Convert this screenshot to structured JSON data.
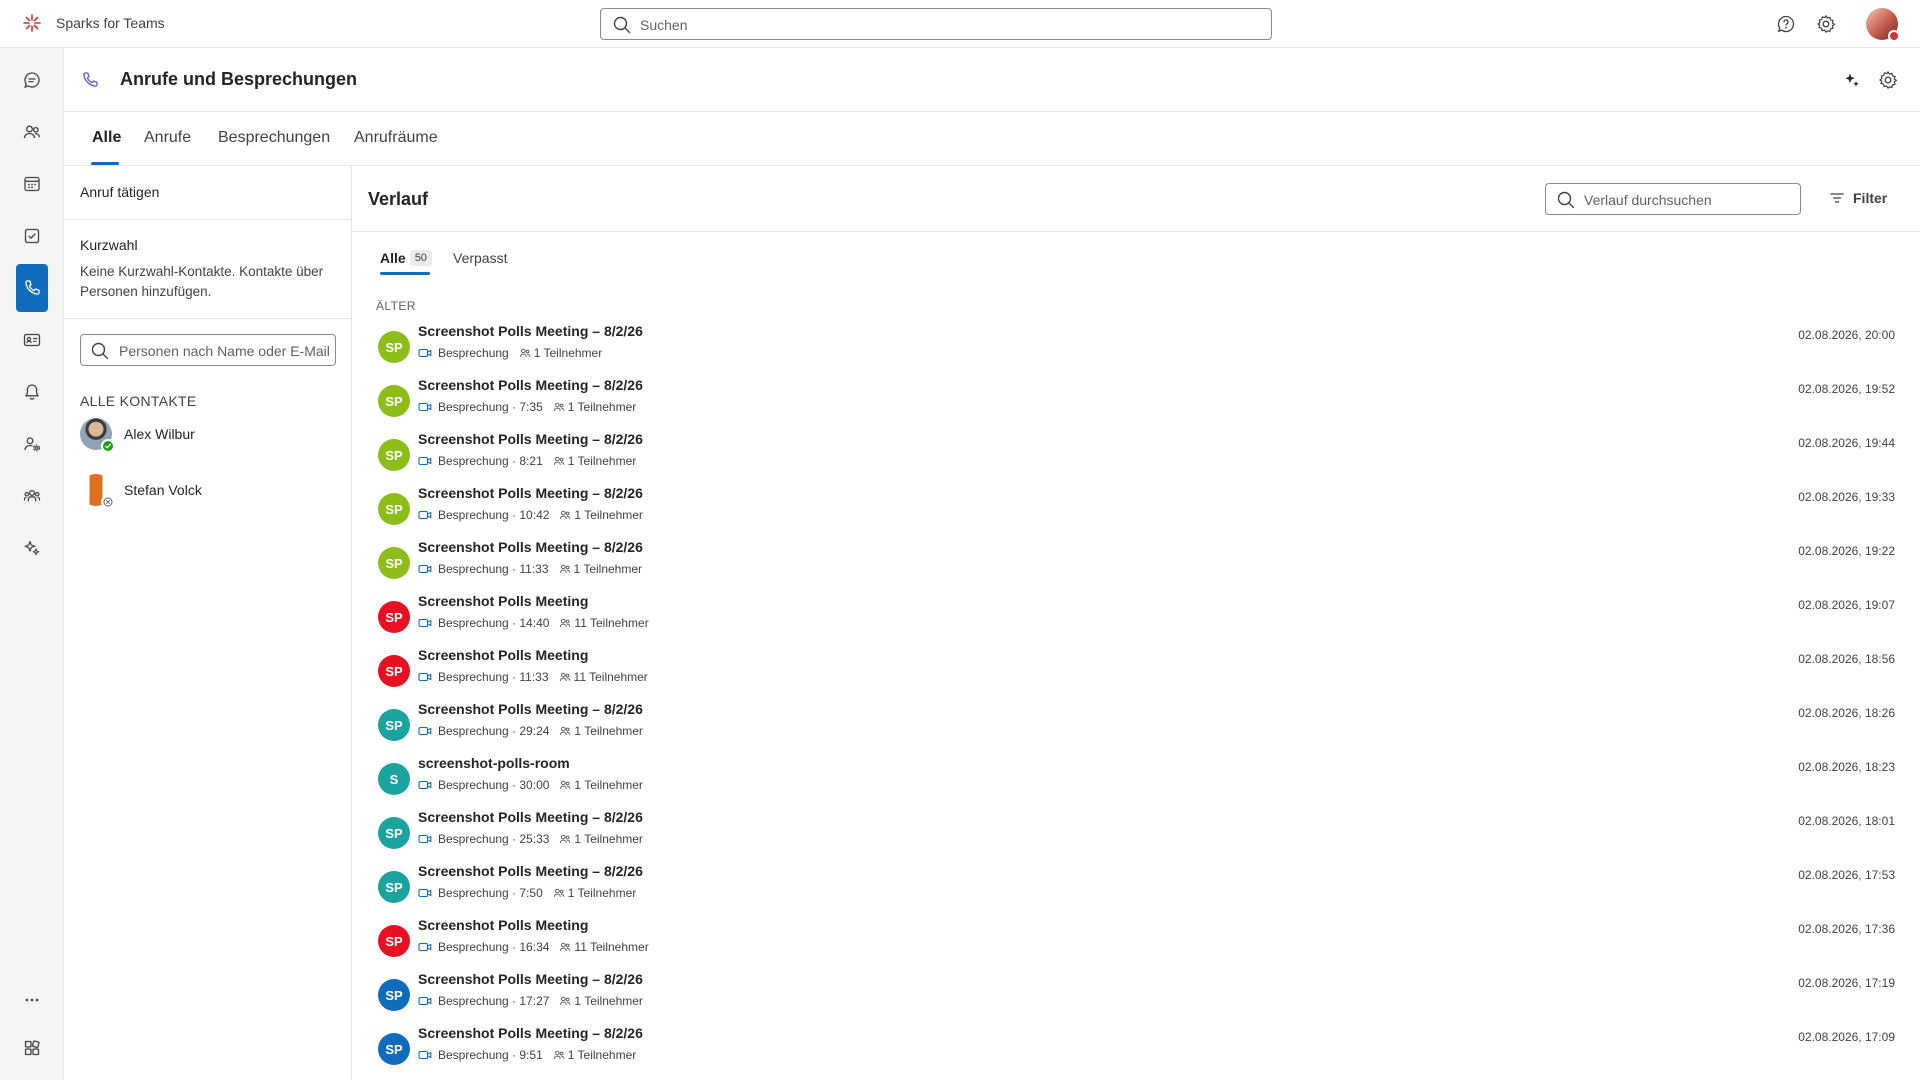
{
  "app": {
    "title": "Sparks for Teams"
  },
  "topbar": {
    "search_placeholder": "Suchen"
  },
  "page": {
    "title": "Anrufe und Besprechungen"
  },
  "tabs": [
    {
      "label": "Alle",
      "active": true
    },
    {
      "label": "Anrufe",
      "active": false
    },
    {
      "label": "Besprechungen",
      "active": false
    },
    {
      "label": "Anrufräume",
      "active": false
    }
  ],
  "left_panel": {
    "make_call": "Anruf tätigen",
    "speed_dial_title": "Kurzwahl",
    "speed_dial_text": "Keine Kurzwahl-Kontakte. Kontakte über Personen hinzufügen.",
    "people_search_placeholder": "Personen nach Name oder E-Mail",
    "all_contacts_label": "ALLE KONTAKTE",
    "contacts": [
      {
        "name": "Alex Wilbur",
        "presence": "available"
      },
      {
        "name": "Stefan Volck",
        "presence": "offline"
      }
    ]
  },
  "history": {
    "title": "Verlauf",
    "search_placeholder": "Verlauf durchsuchen",
    "filter_label": "Filter",
    "subtab_all": "Alle",
    "subtab_all_count": "50",
    "subtab_missed": "Verpasst",
    "section_label": "ÄLTER",
    "rows": [
      {
        "initials": "SP",
        "color": "#8cbd18",
        "title": "Screenshot Polls Meeting – 8/2/26",
        "meta": "Besprechung",
        "participants": "1 Teilnehmer",
        "time": "02.08.2026, 20:00"
      },
      {
        "initials": "SP",
        "color": "#8cbd18",
        "title": "Screenshot Polls Meeting – 8/2/26",
        "meta": "Besprechung · 7:35",
        "participants": "1 Teilnehmer",
        "time": "02.08.2026, 19:52"
      },
      {
        "initials": "SP",
        "color": "#8cbd18",
        "title": "Screenshot Polls Meeting – 8/2/26",
        "meta": "Besprechung · 8:21",
        "participants": "1 Teilnehmer",
        "time": "02.08.2026, 19:44"
      },
      {
        "initials": "SP",
        "color": "#8cbd18",
        "title": "Screenshot Polls Meeting – 8/2/26",
        "meta": "Besprechung · 10:42",
        "participants": "1 Teilnehmer",
        "time": "02.08.2026, 19:33"
      },
      {
        "initials": "SP",
        "color": "#8cbd18",
        "title": "Screenshot Polls Meeting – 8/2/26",
        "meta": "Besprechung · 11:33",
        "participants": "1 Teilnehmer",
        "time": "02.08.2026, 19:22"
      },
      {
        "initials": "SP",
        "color": "#e81123",
        "title": "Screenshot Polls Meeting",
        "meta": "Besprechung · 14:40",
        "participants": "11 Teilnehmer",
        "time": "02.08.2026, 19:07"
      },
      {
        "initials": "SP",
        "color": "#e81123",
        "title": "Screenshot Polls Meeting",
        "meta": "Besprechung · 11:33",
        "participants": "11 Teilnehmer",
        "time": "02.08.2026, 18:56"
      },
      {
        "initials": "SP",
        "color": "#1aa39f",
        "title": "Screenshot Polls Meeting – 8/2/26",
        "meta": "Besprechung · 29:24",
        "participants": "1 Teilnehmer",
        "time": "02.08.2026, 18:26"
      },
      {
        "initials": "S",
        "color": "#1aa39f",
        "title": "screenshot-polls-room",
        "meta": "Besprechung · 30:00",
        "participants": "1 Teilnehmer",
        "time": "02.08.2026, 18:23"
      },
      {
        "initials": "SP",
        "color": "#1aa39f",
        "title": "Screenshot Polls Meeting – 8/2/26",
        "meta": "Besprechung · 25:33",
        "participants": "1 Teilnehmer",
        "time": "02.08.2026, 18:01"
      },
      {
        "initials": "SP",
        "color": "#1aa39f",
        "title": "Screenshot Polls Meeting – 8/2/26",
        "meta": "Besprechung · 7:50",
        "participants": "1 Teilnehmer",
        "time": "02.08.2026, 17:53"
      },
      {
        "initials": "SP",
        "color": "#e81123",
        "title": "Screenshot Polls Meeting",
        "meta": "Besprechung · 16:34",
        "participants": "11 Teilnehmer",
        "time": "02.08.2026, 17:36"
      },
      {
        "initials": "SP",
        "color": "#0f6cbd",
        "title": "Screenshot Polls Meeting – 8/2/26",
        "meta": "Besprechung · 17:27",
        "participants": "1 Teilnehmer",
        "time": "02.08.2026, 17:19"
      },
      {
        "initials": "SP",
        "color": "#0f6cbd",
        "title": "Screenshot Polls Meeting – 8/2/26",
        "meta": "Besprechung · 9:51",
        "participants": "1 Teilnehmer",
        "time": "02.08.2026, 17:09"
      }
    ]
  },
  "rail": {
    "items": [
      {
        "icon": "chat-icon",
        "active": false
      },
      {
        "icon": "people-icon",
        "active": false
      },
      {
        "icon": "calendar-icon",
        "active": false
      },
      {
        "icon": "tasks-icon",
        "active": false
      },
      {
        "icon": "phone-icon",
        "active": true
      },
      {
        "icon": "contact-card-icon",
        "active": false
      },
      {
        "icon": "bell-icon",
        "active": false
      },
      {
        "icon": "people-settings-icon",
        "active": false
      },
      {
        "icon": "teams-icon",
        "active": false
      },
      {
        "icon": "copilot-icon",
        "active": false
      },
      {
        "icon": "more-icon",
        "active": false
      },
      {
        "icon": "apps-icon",
        "active": false
      }
    ]
  },
  "colors": {
    "accent": "#0f6cbd",
    "available": "#13a10e"
  }
}
